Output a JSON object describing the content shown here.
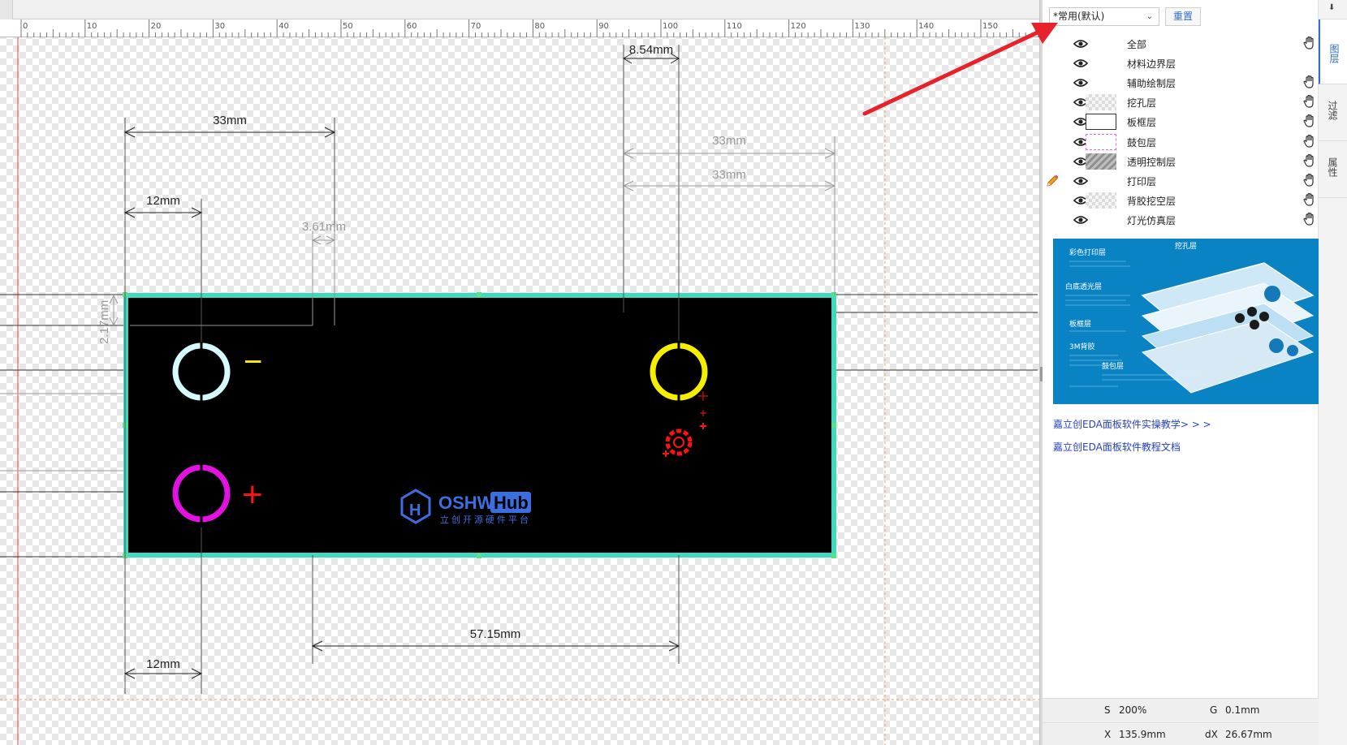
{
  "ruler": {
    "labels": [
      "0",
      "10",
      "20",
      "30",
      "40",
      "50",
      "60",
      "70",
      "80",
      "90",
      "100",
      "110",
      "120",
      "130",
      "140",
      "150"
    ]
  },
  "dimensions": {
    "top_left_width": "33mm",
    "hole_offset_top": "12mm",
    "small_gap": "3.61mm",
    "vertical_gap": "2.17mm",
    "top_right_small": "8.54mm",
    "right_width_1": "33mm",
    "right_width_2": "33mm",
    "bottom_span": "57.15mm",
    "hole_offset_bottom": "12mm"
  },
  "board": {
    "minus_sign": "−",
    "plus_sign": "+",
    "logo_name": "OSHWHub",
    "logo_name_prefix": "OSHW",
    "logo_name_suffix": "Hub",
    "logo_tagline": "立创开源硬件平台"
  },
  "layer_panel": {
    "preset_label": "*常用(默认)",
    "reset_label": "重置",
    "layers": [
      {
        "name": "全部",
        "swatch": "none",
        "hand": true,
        "pencil": false
      },
      {
        "name": "材料边界层",
        "swatch": "none",
        "hand": false,
        "pencil": false
      },
      {
        "name": "辅助绘制层",
        "swatch": "none",
        "hand": true,
        "pencil": false
      },
      {
        "name": "挖孔层",
        "swatch": "check",
        "hand": true,
        "pencil": false
      },
      {
        "name": "板框层",
        "swatch": "frame",
        "hand": true,
        "pencil": false
      },
      {
        "name": "鼓包层",
        "swatch": "emboss",
        "hand": true,
        "pencil": false
      },
      {
        "name": "透明控制层",
        "swatch": "hatch",
        "hand": true,
        "pencil": false
      },
      {
        "name": "打印层",
        "swatch": "none",
        "hand": true,
        "pencil": true
      },
      {
        "name": "背胶挖空层",
        "swatch": "check",
        "hand": true,
        "pencil": false
      },
      {
        "name": "灯光仿真层",
        "swatch": "none",
        "hand": true,
        "pencil": false
      }
    ],
    "diagram_labels": {
      "label_1": "彩色打印层",
      "label_2": "挖孔层",
      "label_3": "白底透光层",
      "label_4": "板框层",
      "label_5": "3M背胶",
      "label_6": "鼓包层"
    },
    "links": {
      "tutorial_video": "嘉立创EDA面板软件实操教学> > >",
      "tutorial_docs": "嘉立创EDA面板软件教程文档"
    }
  },
  "status": {
    "s_label": "S",
    "s_value": "200%",
    "g_label": "G",
    "g_value": "0.1mm",
    "x_label": "X",
    "x_value": "135.9mm",
    "dx_label": "dX",
    "dx_value": "26.67mm"
  },
  "side_tabs": {
    "layers": "图层",
    "filter": "过滤",
    "properties": "属性"
  },
  "colors": {
    "board_fill": "#000000",
    "board_outline": "#3fd9c0",
    "hole_top_left": "#d6fbff",
    "hole_bottom_left": "#e312e3",
    "hole_top_right": "#f5ee00",
    "minus_color": "#ffee00",
    "plus_color": "#ff1111",
    "gear_color": "#ff1111",
    "logo_blue": "#3b6fe0",
    "accent": "#2e6fd0",
    "arrow": "#e8222a"
  }
}
